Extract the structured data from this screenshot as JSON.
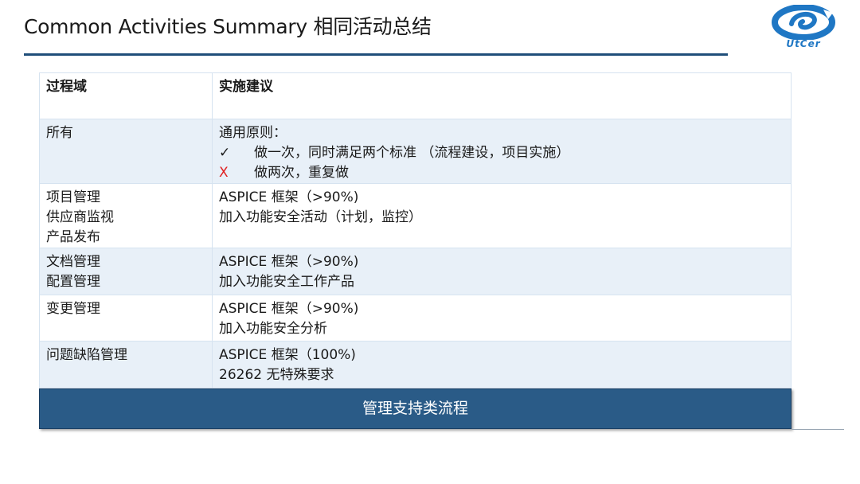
{
  "slide": {
    "title": "Common Activities Summary 相同活动总结"
  },
  "logo": {
    "text": "UtCer"
  },
  "table": {
    "header": {
      "col1": "过程域",
      "col2": "实施建议"
    },
    "rows": [
      {
        "domain": [
          "所有"
        ],
        "advice": {
          "intro": "通用原则：",
          "items": [
            {
              "mark": "✓",
              "text": "做一次，同时满足两个标准 （流程建设，项目实施）"
            },
            {
              "mark": "X",
              "text": "做两次，重复做"
            }
          ]
        }
      },
      {
        "domain": [
          "项目管理",
          "供应商监视",
          "产品发布"
        ],
        "advice": [
          "ASPICE 框架（>90%)",
          "加入功能安全活动（计划，监控）"
        ]
      },
      {
        "domain": [
          "文档管理",
          "配置管理"
        ],
        "advice": [
          "ASPICE 框架（>90%)",
          "加入功能安全工作产品"
        ]
      },
      {
        "domain": [
          "变更管理"
        ],
        "advice": [
          "ASPICE 框架（>90%)",
          "加入功能安全分析"
        ]
      },
      {
        "domain": [
          "问题缺陷管理"
        ],
        "advice": [
          "ASPICE 框架（100%)",
          "26262 无特殊要求"
        ]
      }
    ]
  },
  "footer": {
    "label": "管理支持类流程"
  },
  "colors": {
    "accent": "#1f4e79",
    "footer_bg": "#2a5b87",
    "row_alt": "#e8f0f8",
    "border": "#d6e3f0",
    "x_mark": "#e02020",
    "logo": "#1f77c4"
  }
}
